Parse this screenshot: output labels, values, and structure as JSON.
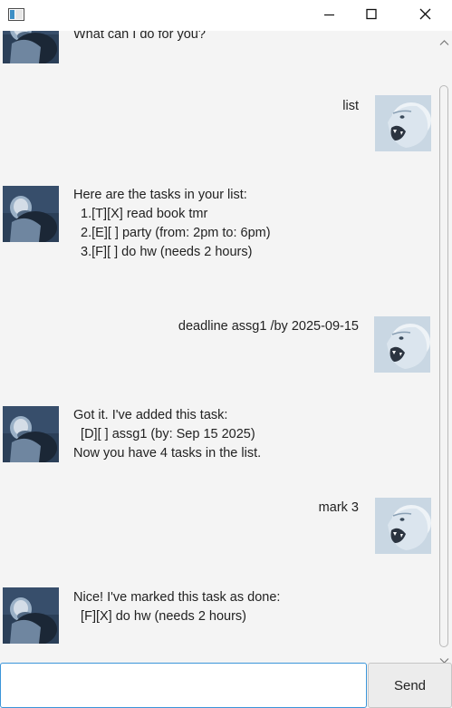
{
  "window": {
    "icons": {
      "app": "app-window-icon",
      "minimize": "minimize-icon",
      "maximize": "maximize-icon",
      "close": "close-icon"
    }
  },
  "dialog": [
    {
      "speaker": "duke",
      "avatar": "monkey-avatar",
      "text": "What can I do for you?"
    },
    {
      "speaker": "user",
      "avatar": "lion-avatar",
      "text": "list"
    },
    {
      "speaker": "duke",
      "avatar": "monkey-avatar",
      "text": "Here are the tasks in your list:\n  1.[T][X] read book tmr\n  2.[E][ ] party (from: 2pm to: 6pm)\n  3.[F][ ] do hw (needs 2 hours)"
    },
    {
      "speaker": "user",
      "avatar": "lion-avatar",
      "text": "deadline assg1 /by 2025-09-15"
    },
    {
      "speaker": "duke",
      "avatar": "monkey-avatar",
      "text": "Got it. I've added this task:\n  [D][ ] assg1 (by: Sep 15 2025)\nNow you have 4 tasks in the list."
    },
    {
      "speaker": "user",
      "avatar": "lion-avatar",
      "text": "mark 3"
    },
    {
      "speaker": "duke",
      "avatar": "monkey-avatar",
      "text": "Nice! I've marked this task as done:\n  [F][X] do hw (needs 2 hours)"
    }
  ],
  "input": {
    "value": "",
    "placeholder": ""
  },
  "send_button": {
    "label": "Send"
  },
  "colors": {
    "background": "#f4f4f4",
    "input_focus_border": "#3b95d9",
    "button_bg": "#ececec"
  }
}
